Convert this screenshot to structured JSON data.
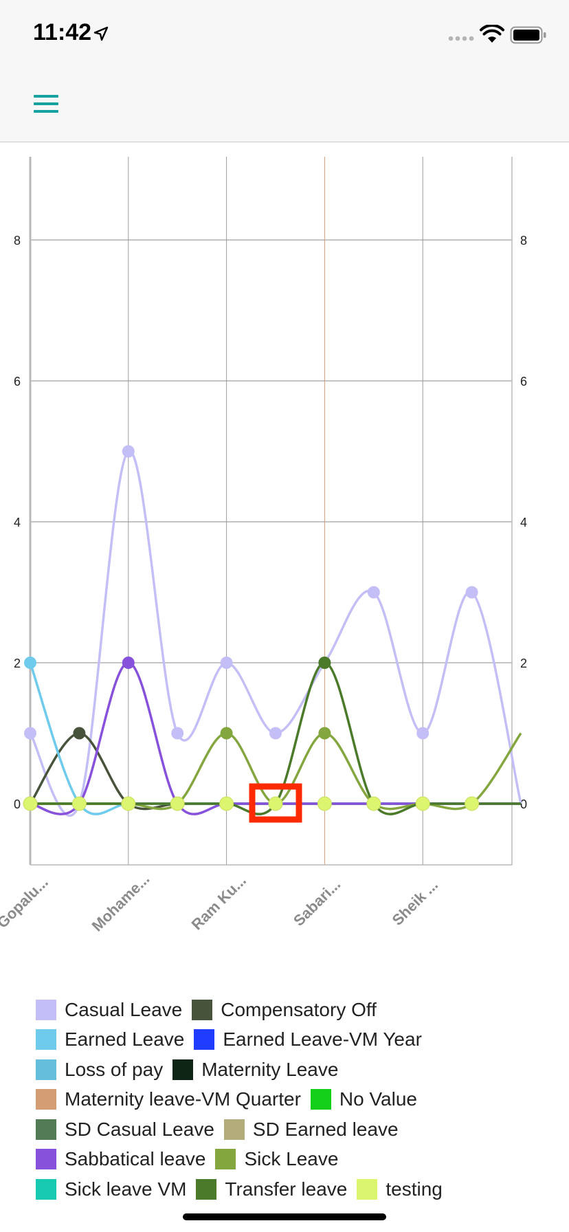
{
  "status_bar": {
    "time": "11:42"
  },
  "colors": {
    "accent": "#17a2a2",
    "highlight_box": "#ff2a00",
    "grid": "#888888",
    "axis_label": "#8a8a8a"
  },
  "icons": {
    "location": "location-arrow-icon",
    "signal": "cellular-signal-icon",
    "wifi": "wifi-icon",
    "battery": "battery-icon",
    "menu": "hamburger-menu-icon"
  },
  "chart_data": {
    "type": "line",
    "categories": [
      "Gopalu...",
      "",
      "Mohame...",
      "",
      "Ram Ku...",
      "",
      "Sabari...",
      "",
      "Sheik ...",
      "",
      ""
    ],
    "category_labels_shown_at": [
      0,
      2,
      4,
      6,
      8
    ],
    "y_ticks": [
      "0",
      "2",
      "4",
      "6",
      "8"
    ],
    "ylim": [
      -0.9,
      9.2
    ],
    "smooth": true,
    "highlight_point_index": 5,
    "series": [
      {
        "name": "Casual Leave",
        "color": "#c4bef6",
        "values": [
          1,
          0,
          5,
          1,
          2,
          1,
          2,
          3,
          1,
          3,
          0
        ]
      },
      {
        "name": "Compensatory Off",
        "color": "#47533a",
        "values": [
          0,
          1,
          0,
          0,
          0,
          0,
          0,
          0,
          0,
          0,
          0
        ]
      },
      {
        "name": "Earned Leave",
        "color": "#6fcbec",
        "values": [
          2,
          0,
          0,
          0,
          0,
          0,
          0,
          0,
          0,
          0,
          0
        ]
      },
      {
        "name": "Earned Leave-VM Year",
        "color": "#1f3cff",
        "values": [
          0,
          0,
          0,
          0,
          0,
          0,
          0,
          0,
          0,
          0,
          0
        ]
      },
      {
        "name": "Loss of pay",
        "color": "#64bfdc",
        "values": [
          0,
          0,
          0,
          0,
          0,
          0,
          0,
          0,
          0,
          0,
          0
        ]
      },
      {
        "name": "Maternity Leave",
        "color": "#0e2414",
        "values": [
          0,
          0,
          0,
          0,
          0,
          0,
          0,
          0,
          0,
          0,
          0
        ]
      },
      {
        "name": "Maternity leave-VM Quarter",
        "color": "#d59d74",
        "values": [
          0,
          0,
          0,
          0,
          0,
          0,
          0,
          0,
          0,
          0,
          0
        ]
      },
      {
        "name": "No Value",
        "color": "#13cf1a",
        "values": [
          0,
          0,
          0,
          0,
          0,
          0,
          0,
          0,
          0,
          0,
          0
        ]
      },
      {
        "name": "SD Casual Leave",
        "color": "#517c55",
        "values": [
          0,
          0,
          0,
          0,
          0,
          0,
          0,
          0,
          0,
          0,
          0
        ]
      },
      {
        "name": "SD Earned leave",
        "color": "#b2ad7b",
        "values": [
          0,
          0,
          0,
          0,
          0,
          0,
          0,
          0,
          0,
          0,
          0
        ]
      },
      {
        "name": "Sabbatical leave",
        "color": "#8751db",
        "values": [
          0,
          0,
          2,
          0,
          0,
          0,
          0,
          0,
          0,
          0,
          0
        ]
      },
      {
        "name": "Sick Leave",
        "color": "#84a63f",
        "values": [
          0,
          0,
          0,
          0,
          1,
          0,
          1,
          0,
          0,
          0,
          1
        ]
      },
      {
        "name": "Sick leave VM",
        "color": "#17c9b0",
        "values": [
          0,
          0,
          0,
          0,
          0,
          0,
          0,
          0,
          0,
          0,
          0
        ]
      },
      {
        "name": "Transfer leave",
        "color": "#4a7a2a",
        "values": [
          0,
          0,
          0,
          0,
          0,
          0,
          2,
          0,
          0,
          0,
          0
        ]
      },
      {
        "name": "testing",
        "color": "#dcf56f",
        "values": [
          0,
          0,
          0,
          0,
          0,
          0,
          0,
          0,
          0,
          0,
          0
        ]
      }
    ],
    "legend_placement": "bottom",
    "grid": true
  },
  "legend_rows": [
    [
      0,
      1
    ],
    [
      2,
      3
    ],
    [
      4,
      5
    ],
    [
      6,
      7
    ],
    [
      8,
      9
    ],
    [
      10,
      11
    ],
    [
      12,
      13,
      14
    ]
  ]
}
